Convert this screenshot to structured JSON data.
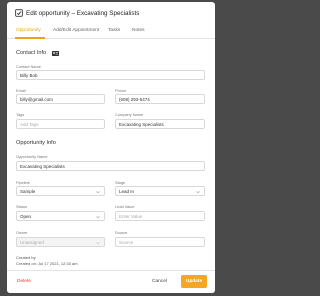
{
  "title": "Edit opportunity – Excavating Specialists",
  "tabs": [
    "Opportunity",
    "Add/Edit Appointment",
    "Tasks",
    "Notes"
  ],
  "contact_info": {
    "heading": "Contact Info",
    "contact_name_label": "Contact Name",
    "contact_name": "Billy Bob",
    "email_label": "Email",
    "email": "billy@gmail.com",
    "phone_label": "Phone",
    "phone": "(608) 293-5474",
    "tags_label": "Tags",
    "tags_placeholder": "Add Tags",
    "company_label": "Company Name",
    "company": "Excavating Specialists"
  },
  "opportunity_info": {
    "heading": "Opportunity Info",
    "opportunity_name_label": "Opportunity Name",
    "opportunity_name": "Excavating Specialists",
    "pipeline_label": "Pipeline",
    "pipeline": "Sample",
    "stage_label": "Stage",
    "stage": "Lead In",
    "status_label": "Status",
    "status": "Open",
    "lead_value_label": "Lead Value",
    "lead_value_placeholder": "Enter Value",
    "owner_label": "Owner",
    "owner": "Unassigned",
    "source_label": "Source",
    "source_placeholder": "Source"
  },
  "meta": {
    "created_by": "Created by",
    "created_on": "Created on: Jul 17 2021, 12:33 am"
  },
  "footer": {
    "delete_label": "Delete",
    "cancel_label": "Cancel",
    "update_label": "Update"
  },
  "colors": {
    "accent": "#e8a317",
    "update_button": "#f5a623",
    "delete": "#e53935"
  }
}
